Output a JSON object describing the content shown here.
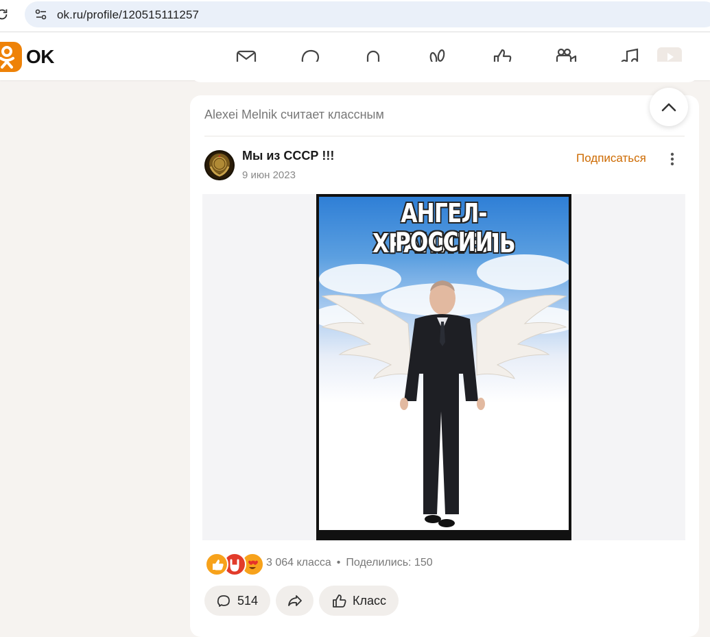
{
  "browser": {
    "url": "ok.ru/profile/120515111257"
  },
  "header": {
    "logo_text": "OK",
    "brand_color": "#ee8208",
    "nav_icons": [
      "messages-icon",
      "discussions-icon",
      "notifications-icon",
      "guests-icon",
      "events-icon",
      "video-icon",
      "music-icon",
      "video-showcase-icon"
    ]
  },
  "post": {
    "liked_by": "Alexei Melnik считает классным",
    "group_name": "Мы из СССР !!!",
    "date": "9 июн 2023",
    "subscribe_label": "Подписаться",
    "image_title_line1": "АНГЕЛ-ХРАНИТЕЛЬ",
    "image_title_line2": "РОССИИ",
    "reactions_count": "3 064 класса",
    "separator": "•",
    "shares": "Поделились: 150",
    "comments_count": "514",
    "klass_label": "Класс"
  }
}
